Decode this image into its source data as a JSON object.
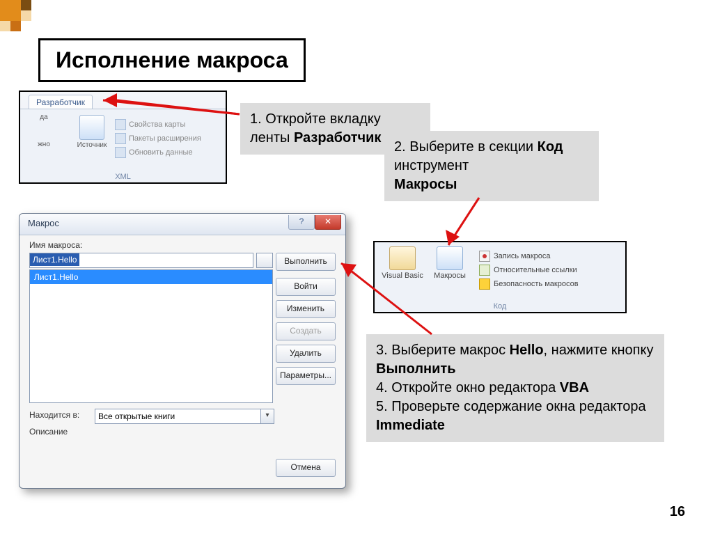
{
  "title": "Исполнение макроса",
  "page_number": "16",
  "ribbon": {
    "tab_label": "Разработчик",
    "left_label1": "да",
    "left_label2": "жно",
    "source_label": "Источник",
    "prop_map": "Свойства карты",
    "prop_pack": "Пакеты расширения",
    "prop_refresh": "Обновить данные",
    "group_label": "XML"
  },
  "callout1_a": "1. Откройте вкладку ленты ",
  "callout1_b": "Разработчик",
  "callout2_a": "2. Выберите в секции ",
  "callout2_b": "Код",
  "callout2_c": " инструмент ",
  "callout2_d": "Макросы",
  "codegroup": {
    "vb_label": "Visual Basic",
    "macros_label": "Макросы",
    "record": "Запись макроса",
    "relative": "Относительные ссылки",
    "security": "Безопасность макросов",
    "group_label": "Код"
  },
  "callout3_a": "3. Выберите макрос ",
  "callout3_b": "Hello",
  "callout3_c": ", нажмите кнопку ",
  "callout3_d": "Выполнить",
  "callout3_e": "4. Откройте окно редактора ",
  "callout3_f": "VBA",
  "callout3_g": "5. Проверьте  содержание окна редактора ",
  "callout3_h": "Immediate",
  "dialog": {
    "title": "Макрос",
    "help": "?",
    "close": "✕",
    "name_label": "Имя макроса:",
    "name_value": "Лист1.Hello",
    "list_item": "Лист1.Hello",
    "btn_run": "Выполнить",
    "btn_step": "Войти",
    "btn_edit": "Изменить",
    "btn_create": "Создать",
    "btn_delete": "Удалить",
    "btn_params": "Параметры...",
    "btn_cancel": "Отмена",
    "in_label": "Находится в:",
    "in_value": "Все открытые книги",
    "desc_label": "Описание"
  }
}
